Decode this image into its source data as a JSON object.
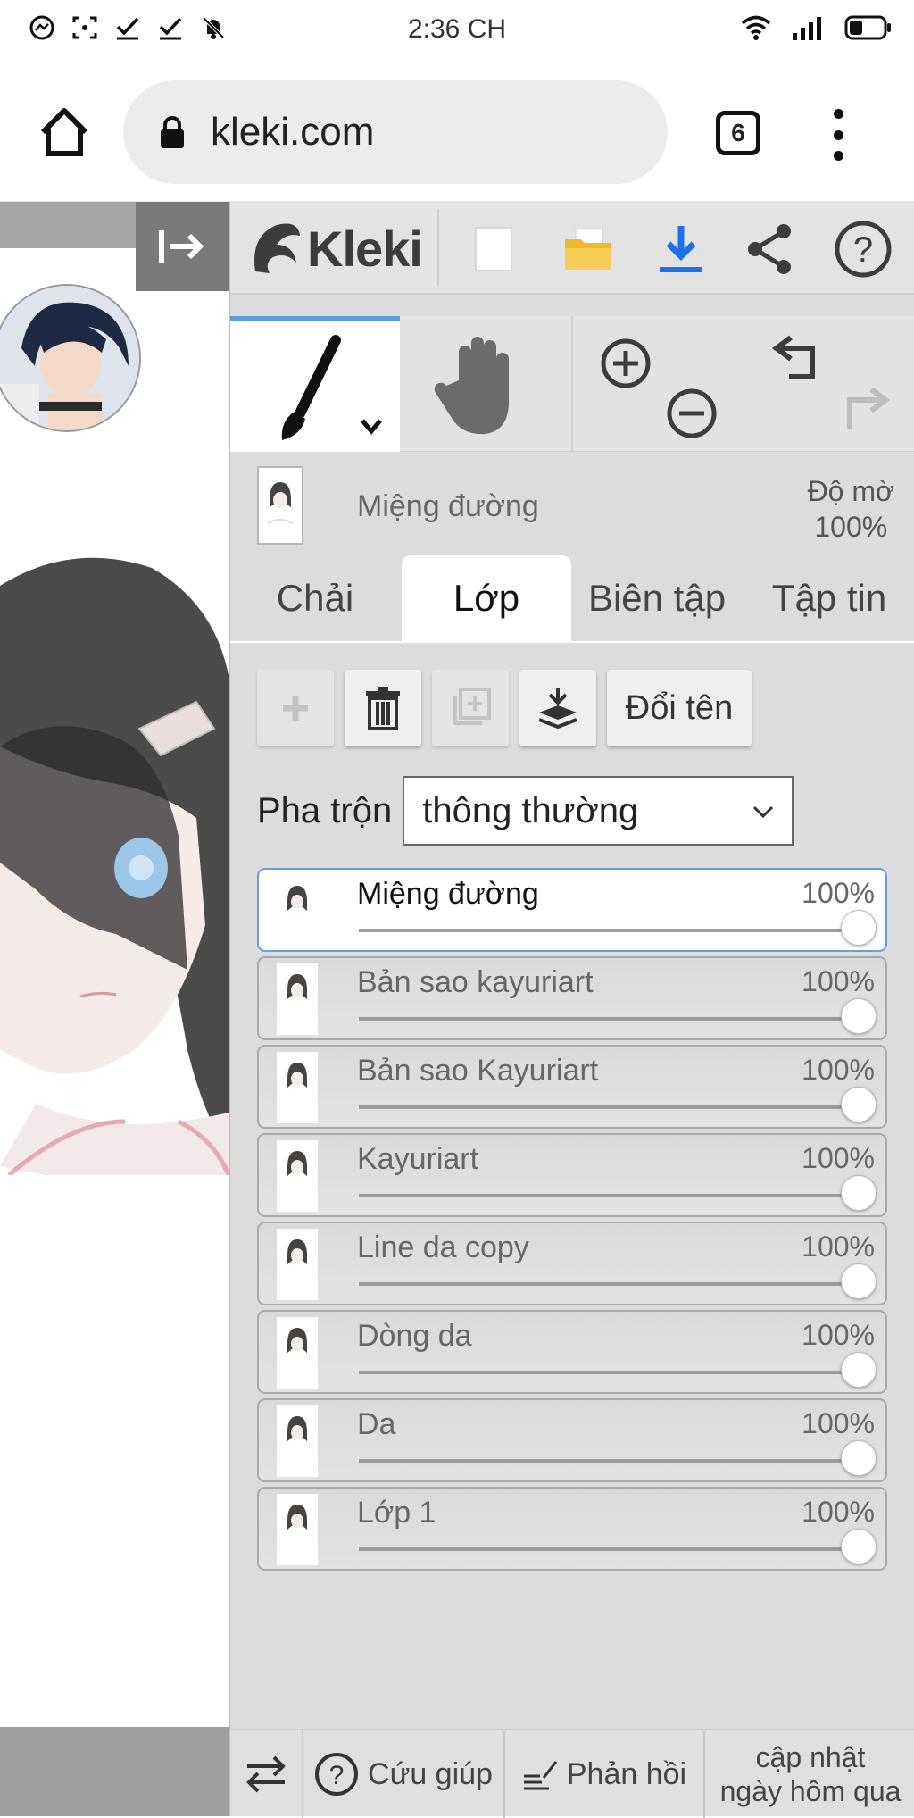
{
  "status_bar": {
    "time": "2:36 CH",
    "left_icons": [
      "messenger-icon",
      "screenshot-icon",
      "check-icon",
      "check-icon",
      "bell-off-icon"
    ],
    "right_icons": [
      "wifi-icon",
      "signal-icon",
      "battery-icon"
    ]
  },
  "browser": {
    "url": "kleki.com",
    "tab_count": "6"
  },
  "app": {
    "name": "Kleki",
    "header_icons": [
      "new-file-icon",
      "open-folder-icon",
      "download-icon",
      "share-icon",
      "help-icon"
    ],
    "current_layer": {
      "name": "Miệng đường",
      "opacity_label": "Độ mờ",
      "opacity_value": "100%"
    },
    "tabs": [
      {
        "label": "Chải",
        "active": false
      },
      {
        "label": "Lớp",
        "active": true
      },
      {
        "label": "Biên tập",
        "active": false
      },
      {
        "label": "Tập tin",
        "active": false
      }
    ],
    "layer_buttons": {
      "rename_label": "Đổi tên"
    },
    "blend": {
      "label": "Pha trộn",
      "value": "thông thường"
    },
    "layers": [
      {
        "name": "Miệng đường",
        "opacity": "100%",
        "selected": true
      },
      {
        "name": "Bản sao kayuriart",
        "opacity": "100%",
        "selected": false
      },
      {
        "name": "Bản sao Kayuriart",
        "opacity": "100%",
        "selected": false
      },
      {
        "name": "Kayuriart",
        "opacity": "100%",
        "selected": false
      },
      {
        "name": "Line da copy",
        "opacity": "100%",
        "selected": false
      },
      {
        "name": "Dòng da",
        "opacity": "100%",
        "selected": false
      },
      {
        "name": "Da",
        "opacity": "100%",
        "selected": false
      },
      {
        "name": "Lớp 1",
        "opacity": "100%",
        "selected": false
      }
    ],
    "footer": {
      "help_label": "Cứu giúp",
      "feedback_label": "Phản hồi",
      "update_line1": "cập nhật",
      "update_line2": "ngày hôm qua"
    }
  },
  "colors": {
    "accent_blue": "#1a73e8",
    "folder_yellow": "#f0b92f",
    "selected_border": "#6a9de0"
  }
}
